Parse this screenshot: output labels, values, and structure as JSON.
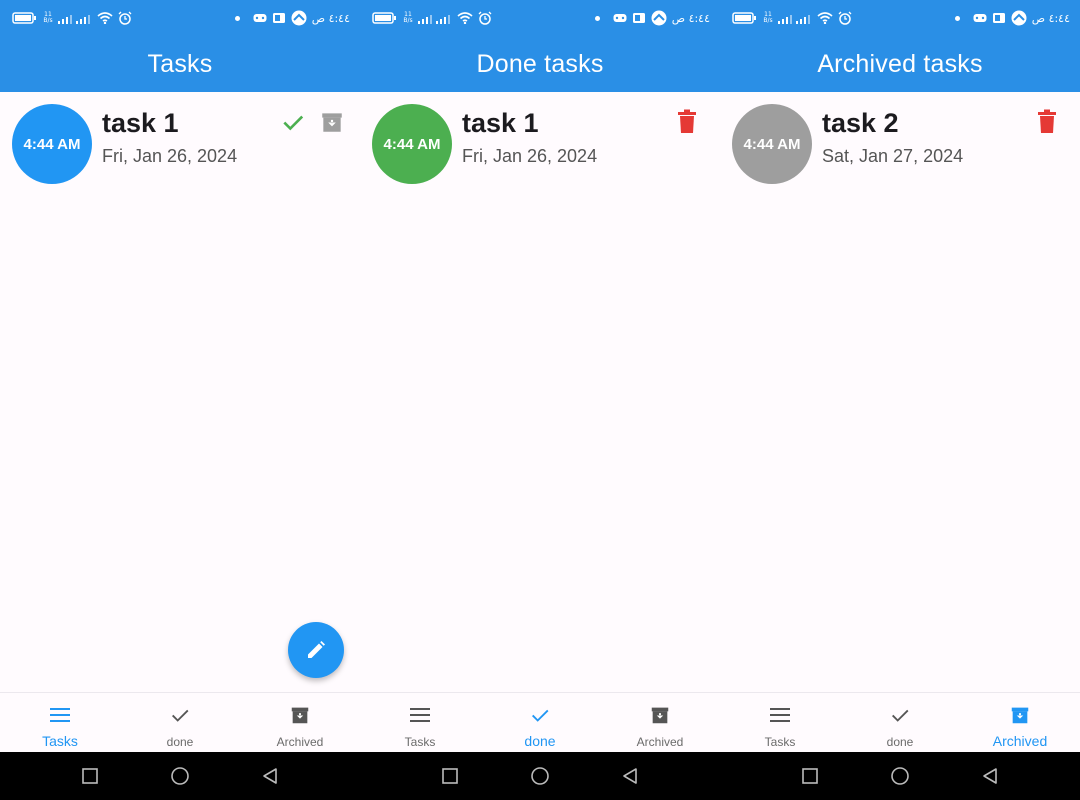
{
  "status_bar": {
    "time": "٤:٤٤ ص",
    "speed_top": "11",
    "speed_bottom": "B/s"
  },
  "colors": {
    "app_bar": "#2a8fe6",
    "accent": "#2196f3",
    "done_green": "#4caf50",
    "archived_gray": "#9e9e9e",
    "delete_red": "#e53935"
  },
  "screens": [
    {
      "title": "Tasks",
      "task": {
        "time": "4:44 AM",
        "title": "task 1",
        "date": "Fri, Jan 26, 2024",
        "avatar_color": "#2196f3",
        "actions": [
          "check-icon",
          "archive-icon"
        ]
      },
      "has_fab": true,
      "active_tab": "Tasks"
    },
    {
      "title": "Done tasks",
      "task": {
        "time": "4:44 AM",
        "title": "task 1",
        "date": "Fri, Jan 26, 2024",
        "avatar_color": "#4caf50",
        "actions": [
          "trash-icon"
        ]
      },
      "has_fab": false,
      "active_tab": "done"
    },
    {
      "title": "Archived tasks",
      "task": {
        "time": "4:44 AM",
        "title": "task 2",
        "date": "Sat, Jan 27, 2024",
        "avatar_color": "#9e9e9e",
        "actions": [
          "trash-icon"
        ]
      },
      "has_fab": false,
      "active_tab": "Archived"
    }
  ],
  "bottom_nav": {
    "items": [
      {
        "label": "Tasks",
        "icon": "menu-icon"
      },
      {
        "label": "done",
        "icon": "check-icon"
      },
      {
        "label": "Archived",
        "icon": "archive-icon"
      }
    ]
  }
}
